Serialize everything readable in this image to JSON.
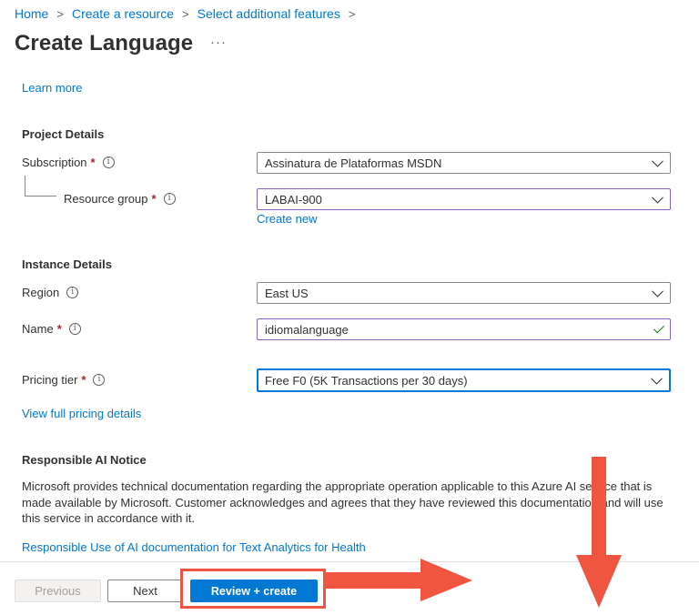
{
  "breadcrumb": {
    "items": [
      "Home",
      "Create a resource",
      "Select additional features"
    ],
    "separator": ">"
  },
  "page": {
    "title": "Create Language",
    "more_label": "···"
  },
  "links": {
    "learn_more": "Learn more",
    "create_new": "Create new",
    "view_pricing": "View full pricing details",
    "responsible_use": "Responsible Use of AI documentation for Text Analytics for Health"
  },
  "project_details": {
    "heading": "Project Details",
    "subscription": {
      "label": "Subscription",
      "required": "*",
      "value": "Assinatura de Plataformas MSDN"
    },
    "resource_group": {
      "label": "Resource group",
      "required": "*",
      "value": "LABAI-900"
    }
  },
  "instance_details": {
    "heading": "Instance Details",
    "region": {
      "label": "Region",
      "value": "East US"
    },
    "name": {
      "label": "Name",
      "required": "*",
      "value": "idiomalanguage"
    },
    "pricing_tier": {
      "label": "Pricing tier",
      "required": "*",
      "value": "Free F0 (5K Transactions per 30 days)"
    }
  },
  "responsible_ai": {
    "heading": "Responsible AI Notice",
    "text": "Microsoft provides technical documentation regarding the appropriate operation applicable to this Azure AI service that is made available by Microsoft. Customer acknowledges and agrees that they have reviewed this documentation and will use this service in accordance with it."
  },
  "footer": {
    "previous_label": "Previous",
    "next_label": "Next",
    "review_create_label": "Review + create"
  },
  "icons": {
    "info": "info-icon",
    "dropdown": "chevron-down-icon",
    "valid": "checkmark-icon"
  },
  "colors": {
    "accent": "#0078d4",
    "required": "#a4262c",
    "annotation": "#f0553f",
    "valid": "#107c10"
  }
}
